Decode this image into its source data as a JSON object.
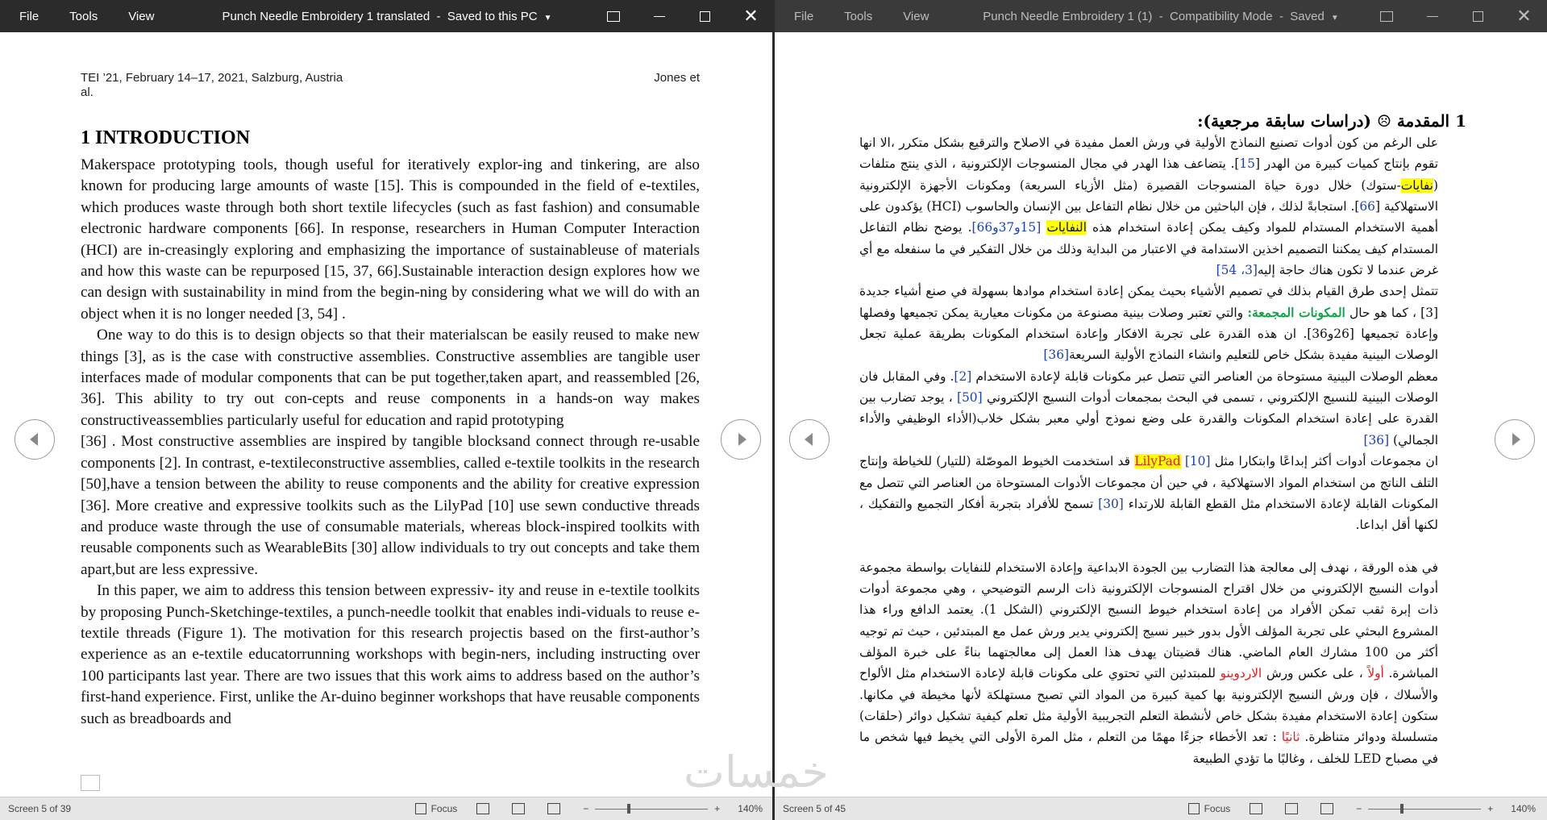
{
  "left": {
    "menu": [
      "File",
      "Tools",
      "View"
    ],
    "title": "Punch Needle Embroidery 1 translated",
    "save_status": "Saved to this PC",
    "header_left": "TEI ’21, February 14–17, 2021, Salzburg, Austria al.",
    "header_right": "Jones et",
    "heading": "1 INTRODUCTION",
    "paragraphs": [
      "Makerspace prototyping tools, though useful for iteratively explor-ing and tinkering, are also known for producing large amounts of waste [15]. This is compounded in the field of e-textiles, which produces waste through both short textile lifecycles (such as fast fashion) and consumable electronic hardware components [66]. In response, researchers in Human Computer Interaction (HCI) are in-creasingly exploring and emphasizing the importance of sustainableuse of materials and how this waste can be repurposed [15, 37, 66].Sustainable interaction design explores how we can design with sustainability in mind from the begin-ning by considering what we will do with an object when it is no longer needed [3, 54] .",
      "One way to do this is to design objects so that their materialscan be easily reused to make new things [3], as is the case with constructive assemblies. Constructive assemblies are tangible user interfaces made of modular components that can be put together,taken apart, and reassembled [26, 36]. This ability to try out con-cepts and reuse components in a hands-on way makes constructiveassemblies particularly useful for education and rapid prototyping",
      "[36] . Most constructive assemblies are inspired by tangible blocksand connect through re-usable components [2]. In contrast, e-textileconstructive assemblies, called e-textile toolkits in the research [50],have a tension between the ability to reuse components and the ability for creative expression [36]. More creative and expressive toolkits such as the LilyPad [10] use sewn conductive threads and produce waste through the use of consumable materials, whereas block-inspired toolkits with reusable components such as WearableBits [30] allow individuals to try out concepts and take them apart,but are less expressive.",
      "In this paper, we aim to address this tension between expressiv- ity and reuse in e-textile toolkits by proposing Punch-Sketchinge-textiles, a punch-needle toolkit that enables indi-viduals to reuse e-textile threads (Figure 1). The motivation for this research projectis based on the first-author’s experience as an e-textile educatorrunning workshops with begin-ners, including instructing over 100 participants last year. There are two issues that this work aims to address based on the author’s first-hand experience. First, unlike the Ar-duino beginner workshops that have reusable components such as breadboards and"
    ],
    "status_screen": "Screen 5 of 39",
    "focus_label": "Focus",
    "zoom": "140%"
  },
  "right": {
    "menu": [
      "File",
      "Tools",
      "View"
    ],
    "title": "Punch Needle Embroidery 1 (1)",
    "mode": "Compatibility Mode",
    "save_status": "Saved",
    "heading": "1 المقدمة ☹ (دراسات سابقة مرجعية):",
    "ar_p1_a": "على الرغم من كون أدوات تصنيع النماذج الأولية في ورش العمل مفيدة في الاصلاح والترقيع بشكل متكرر ،الا انها تقوم بإنتاج كميات كبيرة من الهدر [",
    "ar_p1_ref15": "15",
    "ar_p1_b": "]. يتضاعف هذا الهدر في مجال المنسوجات الإلكترونية ، الذي ينتج متلفات (",
    "ar_p1_hl1": "نفايات",
    "ar_p1_c": "-ستوك) خلال دورة حياة المنسوجات القصيرة (مثل الأزياء السريعة) ومكونات الأجهزة الإلكترونية الاستهلاكية [",
    "ar_p1_ref66": "66",
    "ar_p1_d": "]. استجابةً لذلك ، فإن الباحثين من خلال نظام التفاعل بين الإنسان والحاسوب (HCI) يؤكدون على أهمية الاستخدام المستدام للمواد وكيف يمكن إعادة استخدام هذه ",
    "ar_p1_hl2": "النفايات",
    "ar_p1_refs": "[15و37و66]",
    "ar_p1_e": ". يوضح نظام التفاعل المستدام كيف يمكننا التصميم اخذين الاستدامة في الاعتبار من البداية وذلك من خلال التفكير في ما سنفعله مع أي غرض عندما لا تكون هناك حاجة إليه",
    "ar_p1_refs2": "[3، 54]",
    "ar_p2_a": "تتمثل إحدى طرق القيام بذلك في تصميم الأشياء بحيث يمكن إعادة استخدام موادها بسهولة في صنع أشياء جديدة [3] ، كما هو حال ",
    "ar_p2_green": "المكونات المجمعة:",
    "ar_p2_b": " والتي تعتبر وصلات بينية مصنوعة من مكونات معيارية يمكن تجميعها وفصلها وإعادة تجميعها [26و36]. ان هذه القدرة على تجربة الافكار وإعادة استخدام المكونات بطريقة عملية تجعل الوصلات البينية مفيدة بشكل خاص للتعليم وانشاء النماذج الأولية السريعة",
    "ar_p2_ref36": "[36]",
    "ar_p3_a": "معظم الوصلات البينية مستوحاة من العناصر التي تتصل عبر مكونات قابلة لإعادة الاستخدام ",
    "ar_p3_ref2": "[2]",
    "ar_p3_b": ". وفي المقابل فان الوصلات البينية للنسيج الإلكتروني ، تسمى في البحث بمجمعات أدوات النسيج الإلكتروني ",
    "ar_p3_ref50": "[50]",
    "ar_p3_c": " ، يوجد تضارب بين القدرة على إعادة استخدام المكونات والقدرة على وضع نموذج أولي معبر بشكل خلاب(الأداء الوظيفي والأداء الجمالي) ",
    "ar_p3_ref36": "[36]",
    "ar_p4_a": "ان مجموعات أدوات أكثر إبداعًا وابتكارا مثل ",
    "ar_p4_lily": "LilyPad",
    "ar_p4_ref10": "[10]",
    "ar_p4_b": " قد استخدمت الخيوط الموصّلة (للتيار) للخياطة وإنتاج التلف الناتج من استخدام المواد الاستهلاكية ، في حين أن مجموعات الأدوات المستوحاة من العناصر التي تتصل مع المكونات القابلة لإعادة الاستخدام مثل القطع القابلة للارتداء ",
    "ar_p4_ref30": "[30]",
    "ar_p4_c": " تسمح للأفراد بتجربة أفكار التجميع والتفكيك ، لكنها أقل ابداعا.",
    "ar_p5_a": "في هذه الورقة ، نهدف إلى معالجة هذا التضارب بين الجودة الابداعية وإعادة الاستخدام للنفايات بواسطة مجموعة أدوات النسيج الإلكتروني من خلال اقتراح المنسوجات الإلكترونية ذات الرسم التوضيحي ، وهي مجموعة أدوات ذات إبرة ثقب تمكن الأفراد من إعادة استخدام خيوط النسيج الإلكتروني (الشكل 1). يعتمد الدافع وراء هذا المشروع البحثي على تجربة المؤلف الأول بدور خبير نسيج إلكتروني يدير ورش عمل مع المبتدئين ، حيث تم توجيه أكثر من 100 مشارك العام الماضي. هناك قضيتان يهدف هذا العمل إلى معالجتهما بناءً على خبرة المؤلف المباشرة. ",
    "ar_p5_red1": "أولاً",
    "ar_p5_b": " ، على عكس ورش ",
    "ar_p5_red2": "الاردوينو",
    "ar_p5_c": " للمبتدئين التي تحتوي على مكونات قابلة لإعادة الاستخدام مثل الألواح والأسلاك ، فإن ورش النسيج الإلكترونية بها كمية كبيرة من المواد التي تصبح مستهلكة لأنها مخيطة في مكانها. ستكون إعادة الاستخدام مفيدة بشكل خاص لأنشطة التعلم التجريبية الأولية مثل تعلم كيفية تشكيل دوائر (حلقات) متسلسلة ودوائر متناظرة. ",
    "ar_p5_red3": "ثانيًا",
    "ar_p5_d": " : تعد الأخطاء جزءًا مهمًا من التعلم ، مثل المرة الأولى التي يخيط فيها شخص ما في مصباح LED للخلف ، وغالبًا ما تؤدي الطبيعة",
    "status_screen": "Screen 5 of 45",
    "focus_label": "Focus",
    "zoom": "140%"
  },
  "watermark": "خمسات"
}
